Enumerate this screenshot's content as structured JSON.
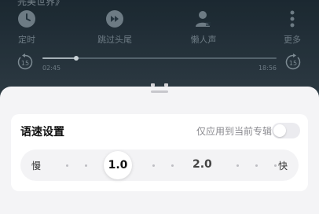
{
  "player": {
    "title_fragment": "完美世界》",
    "controls": [
      {
        "label": "定时",
        "icon": "clock-icon"
      },
      {
        "label": "跳过头尾",
        "icon": "skip-intro-icon"
      },
      {
        "label": "懒人声",
        "icon": "voice-person-icon"
      },
      {
        "label": "更多",
        "icon": "more-vertical-icon"
      }
    ],
    "progress": {
      "elapsed": "02:45",
      "total": "18:56",
      "fraction": 0.145,
      "rewind_seconds": "15",
      "forward_seconds": "15"
    }
  },
  "speed_sheet": {
    "title": "语速设置",
    "scope_label": "仅应用到当前专辑",
    "scope_toggle_on": false,
    "slider": {
      "min_label": "慢",
      "max_label": "快",
      "selected_value": "1.0",
      "mark_value": "2.0"
    }
  },
  "colors": {
    "sheet_background": "#f4f4f6",
    "card_background": "#ffffff",
    "player_background": "#2b3b45"
  }
}
